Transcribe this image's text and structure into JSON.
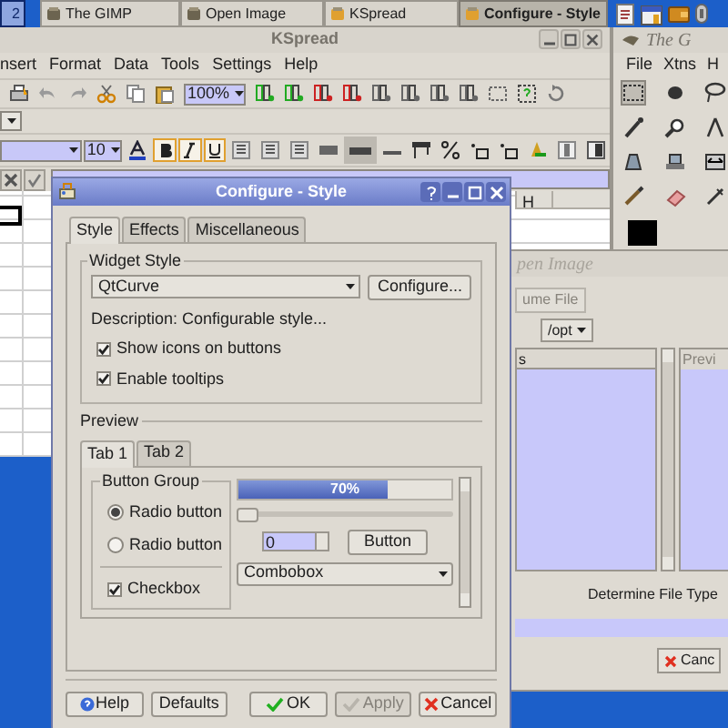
{
  "taskbar": {
    "items": [
      {
        "label": "2",
        "selected": false
      },
      {
        "label": "The GIMP",
        "selected": false
      },
      {
        "label": "Open Image",
        "selected": false
      },
      {
        "label": "KSpread",
        "selected": false
      },
      {
        "label": "Configure - Style",
        "selected": true
      }
    ]
  },
  "kspread": {
    "title": "KSpread",
    "menu": [
      "nsert",
      "Format",
      "Data",
      "Tools",
      "Settings",
      "Help"
    ],
    "zoom": "100%",
    "font_size": "10",
    "column_header": "H"
  },
  "gimp": {
    "title": "The G",
    "menu": [
      "File",
      "Xtns",
      "H"
    ]
  },
  "open_image": {
    "title": "pen Image",
    "file_button": "ume File",
    "path": "/opt",
    "list_header": "s",
    "preview_header": "Previ",
    "file_type": "Determine File Type",
    "cancel": "Canc"
  },
  "configure": {
    "title": "Configure - Style",
    "tabs": [
      {
        "label": "Style",
        "selected": true
      },
      {
        "label": "Effects",
        "selected": false
      },
      {
        "label": "Miscellaneous",
        "selected": false
      }
    ],
    "widget_style": {
      "legend": "Widget Style",
      "style": "QtCurve",
      "configure_button": "Configure...",
      "description": "Description: Configurable style...",
      "options": [
        {
          "label": "Show icons on buttons",
          "checked": true
        },
        {
          "label": "Enable tooltips",
          "checked": true
        }
      ]
    },
    "preview": {
      "legend": "Preview",
      "tabs": [
        {
          "label": "Tab 1",
          "selected": true
        },
        {
          "label": "Tab 2",
          "selected": false
        }
      ],
      "button_group": {
        "legend": "Button Group",
        "radios": [
          {
            "label": "Radio button",
            "selected": true
          },
          {
            "label": "Radio button",
            "selected": false
          }
        ],
        "checkbox": {
          "label": "Checkbox",
          "checked": true
        }
      },
      "progress": {
        "level": 0.7,
        "label": "70%"
      },
      "slider": {
        "level": 0
      },
      "spinbox": "0",
      "button": "Button",
      "combobox": "Combobox"
    },
    "buttons": [
      {
        "label": "Help",
        "kind": "help",
        "disabled": false
      },
      {
        "label": "Defaults",
        "kind": "plain",
        "disabled": false
      },
      {
        "label": "OK",
        "kind": "ok",
        "disabled": false
      },
      {
        "label": "Apply",
        "kind": "ok",
        "disabled": true
      },
      {
        "label": "Cancel",
        "kind": "cancel",
        "disabled": false
      }
    ]
  }
}
